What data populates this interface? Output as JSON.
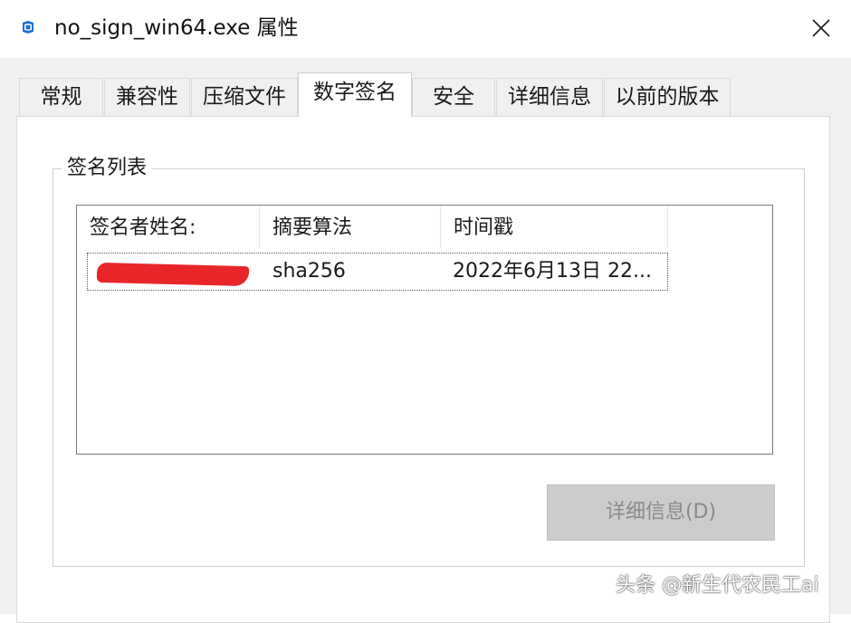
{
  "window": {
    "title": "no_sign_win64.exe 属性",
    "icon": "shield-app-icon"
  },
  "tabs": [
    {
      "label": "常规",
      "active": false
    },
    {
      "label": "兼容性",
      "active": false
    },
    {
      "label": "压缩文件",
      "active": false
    },
    {
      "label": "数字签名",
      "active": true
    },
    {
      "label": "安全",
      "active": false
    },
    {
      "label": "详细信息",
      "active": false
    },
    {
      "label": "以前的版本",
      "active": false
    }
  ],
  "signature_list": {
    "group_label": "签名列表",
    "columns": [
      "签名者姓名:",
      "摘要算法",
      "时间戳"
    ],
    "rows": [
      {
        "signer": "",
        "algorithm": "sha256",
        "timestamp": "2022年6月13日 22..."
      }
    ]
  },
  "details_button": {
    "label": "详细信息(D)",
    "enabled": false
  },
  "watermark": "头条 @新生代农民工ai",
  "colors": {
    "accent": "#1f6fd6",
    "redaction": "#e8262a"
  }
}
